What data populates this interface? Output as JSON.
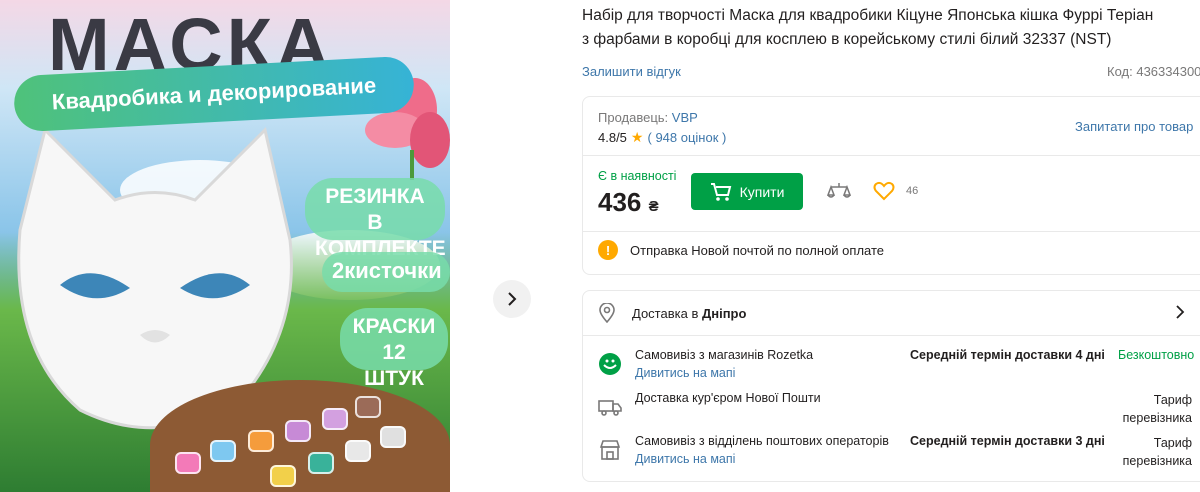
{
  "image": {
    "title": "МАСКА",
    "ribbon": "Квадробика и декорирование",
    "badge1": "РЕЗИНКА В КОМПЛЕКТЕ",
    "badge2": "2кисточки",
    "badge3": "КРАСКИ 12 ШТУК"
  },
  "product": {
    "title_line1": "Набір для творчості Маска для квадробики Кіцуне Японська кішка Фуррі Теріан",
    "title_line2": "з фарбами в коробці для косплею в корейському стилі білий 32337 (NST)",
    "review_link": "Залишити відгук",
    "code_label": "Код:",
    "code_value": "436334300"
  },
  "seller": {
    "label": "Продавець:",
    "name": "VBP",
    "rating": "4.8/5",
    "reviews": "948 оцінок",
    "ask": "Запитати про товар"
  },
  "purchase": {
    "availability": "Є в наявності",
    "price": "436",
    "currency": "₴",
    "buy_label": "Купити",
    "favorites_count": "46",
    "notice": "Отправка Новой почтой по полной оплате"
  },
  "delivery": {
    "label": "Доставка в",
    "city": "Дніпро",
    "options": [
      {
        "name": "Самовивіз з магазинів Rozetka",
        "link": "Дивитись на мапі",
        "term": "Середній термін доставки 4 дні",
        "cost": "Безкоштовно"
      },
      {
        "name": "Доставка кур'єром Нової Пошти",
        "link": "",
        "term": "",
        "cost": "Тариф перевізника"
      },
      {
        "name": "Самовивіз з відділень поштових операторів",
        "link": "Дивитись на мапі",
        "term": "Середній термін доставки 3 дні",
        "cost": "Тариф перевізника"
      }
    ]
  },
  "colors": {
    "accent_green": "#00a046",
    "link_blue": "#3e77aa",
    "star": "#ffa900"
  }
}
